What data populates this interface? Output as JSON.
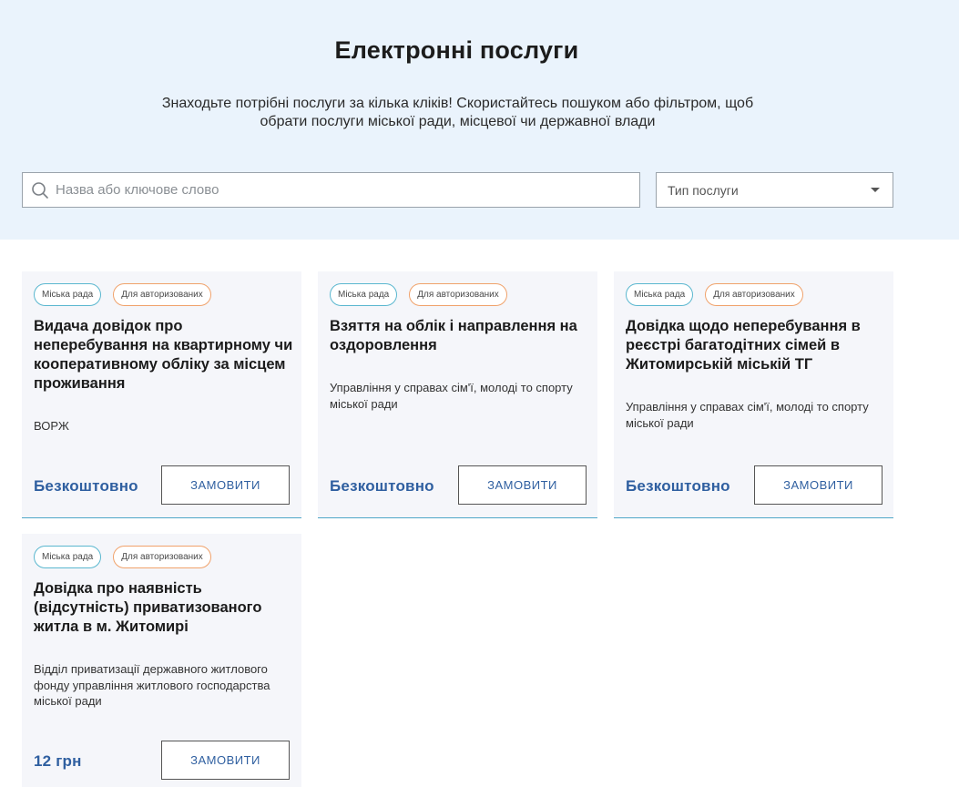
{
  "header": {
    "title": "Електронні послуги",
    "subtitle": "Знаходьте потрібні послуги за кілька кліків! Скористайтесь пошуком або фільтром, щоб обрати послуги міської ради, місцевої чи державної влади"
  },
  "search": {
    "placeholder": "Назва або ключове слово",
    "icon": "search-icon"
  },
  "filter": {
    "selected": "Тип послуги",
    "icon": "chevron-down-icon"
  },
  "colors": {
    "hero_bg": "#eaf3fc",
    "card_bg": "#f5f6fa",
    "accent_blue": "#2f5fa0",
    "badge_city_border": "#5ab7cf",
    "badge_auth_border": "#f0a26b"
  },
  "cards": [
    {
      "badge_city": "Міська рада",
      "badge_auth": "Для авторизованих",
      "title": "Видача довідок про неперебування на квартирному чи кооперативному обліку за місцем проживання",
      "department": "ВОРЖ",
      "price": "Безкоштовно",
      "button": "ЗАМОВИТИ"
    },
    {
      "badge_city": "Міська рада",
      "badge_auth": "Для авторизованих",
      "title": "Взяття на облік і направлення на оздоровлення",
      "department": "Управління у справах сім'ї, молоді то спорту міської ради",
      "price": "Безкоштовно",
      "button": "ЗАМОВИТИ"
    },
    {
      "badge_city": "Міська рада",
      "badge_auth": "Для авторизованих",
      "title": "Довідка щодо неперебування в реєстрі багатодітних сімей в Житомирській міській ТГ",
      "department": "Управління у справах сім'ї, молоді то спорту міської ради",
      "price": "Безкоштовно",
      "button": "ЗАМОВИТИ"
    },
    {
      "badge_city": "Міська рада",
      "badge_auth": "Для авторизованих",
      "title": "Довідка про наявність (відсутність) приватизованого житла в м. Житомирі",
      "department": "Відділ приватизації державного житлового фонду управління житлового господарства міської ради",
      "price": "12 грн",
      "button": "ЗАМОВИТИ"
    }
  ]
}
